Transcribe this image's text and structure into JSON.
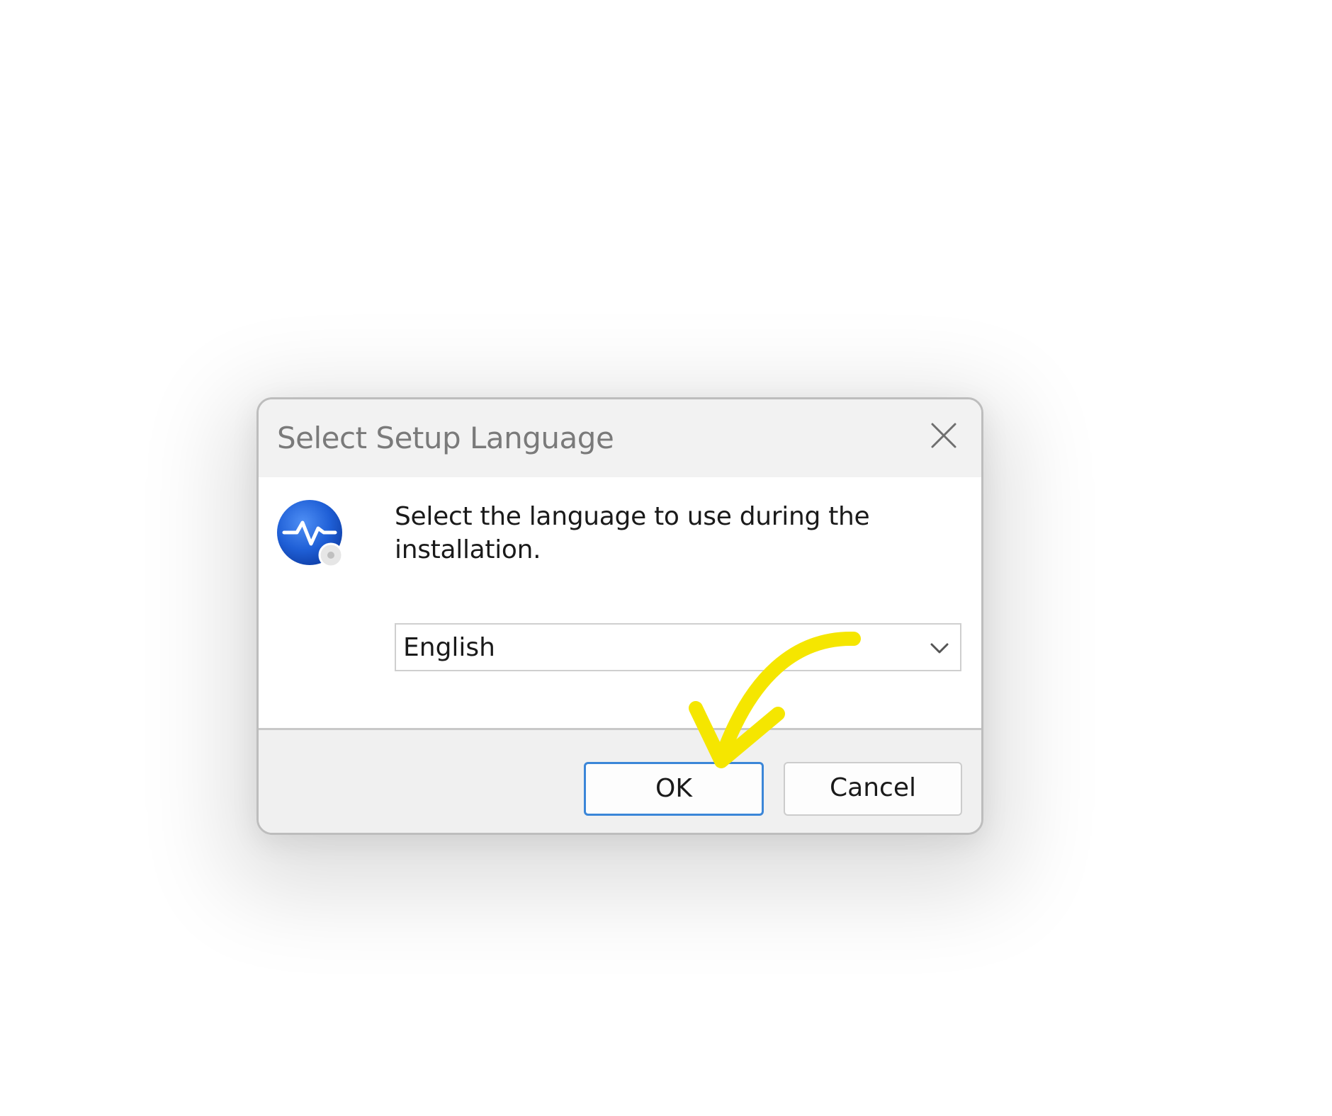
{
  "dialog": {
    "title": "Select Setup Language",
    "prompt": "Select the language to use during the installation.",
    "language_select": {
      "selected": "English"
    },
    "buttons": {
      "ok": "OK",
      "cancel": "Cancel"
    }
  },
  "icons": {
    "close": "close-icon",
    "app": "setup-app-icon",
    "dropdown": "chevron-down-icon",
    "annotation": "pointer-arrow-icon"
  },
  "colors": {
    "accent": "#3b86d8",
    "icon_blue": "#1f5fd6",
    "annotation_arrow": "#f5e600"
  }
}
